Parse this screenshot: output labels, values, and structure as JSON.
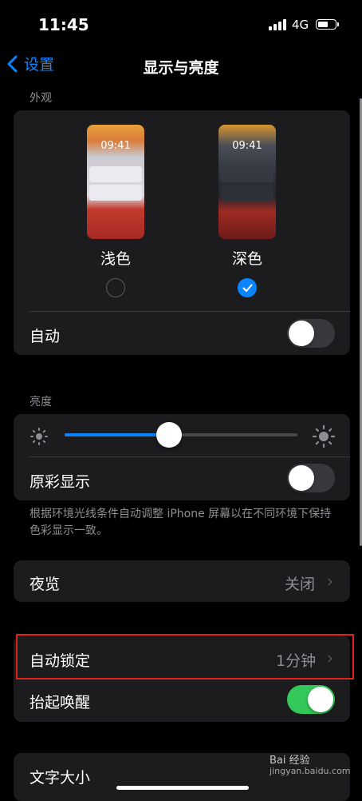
{
  "status": {
    "time": "11:45",
    "network": "4G",
    "signal_icon": "signal-bars-icon",
    "battery_icon": "battery-icon"
  },
  "nav": {
    "back_label": "设置",
    "title": "显示与亮度"
  },
  "appearance": {
    "section_label": "外观",
    "light": {
      "thumb_time": "09:41",
      "label": "浅色",
      "selected": false
    },
    "dark": {
      "thumb_time": "09:41",
      "label": "深色",
      "selected": true
    },
    "auto_label": "自动",
    "auto_on": false
  },
  "brightness": {
    "section_label": "亮度",
    "level": 0.45,
    "true_tone_label": "原彩显示",
    "true_tone_on": false,
    "footer": "根据环境光线条件自动调整 iPhone 屏幕以在不同环境下保持色彩显示一致。"
  },
  "night_shift": {
    "label": "夜览",
    "value": "关闭"
  },
  "lock": {
    "auto_lock_label": "自动锁定",
    "auto_lock_value": "1分钟",
    "raise_to_wake_label": "抬起唤醒",
    "raise_to_wake_on": true
  },
  "text": {
    "text_size_label": "文字大小"
  },
  "watermark": {
    "line1": "Bai 经验",
    "line2": "jingyan.baidu.com"
  },
  "colors": {
    "accent": "#0a84ff",
    "toggle_on": "#34c759",
    "highlight": "#e0201a",
    "card": "#1c1c1e"
  }
}
